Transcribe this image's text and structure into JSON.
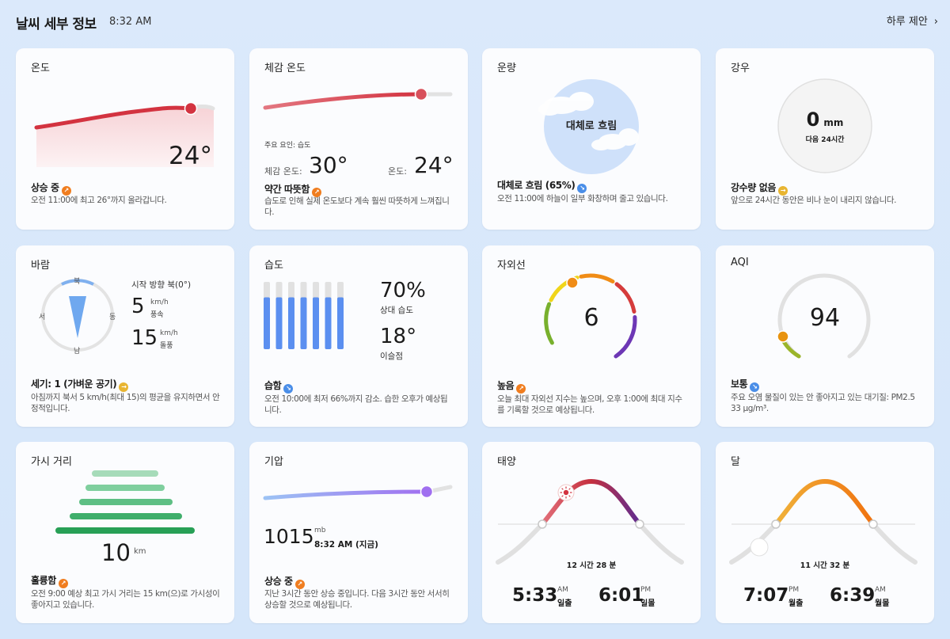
{
  "header": {
    "title": "날씨 세부 정보",
    "time": "8:32 AM",
    "daily_label": "하루 제안"
  },
  "temperature": {
    "title": "온도",
    "value": "24°",
    "status": "상승 중",
    "desc": "오전 11:00에 최고 26°까지 올라갑니다."
  },
  "feels_like": {
    "title": "체감 온도",
    "factor": "주요 요인: 습도",
    "feels_label": "체감 온도:",
    "feels_value": "30°",
    "temp_label": "온도:",
    "temp_value": "24°",
    "status": "약간 따뜻함",
    "desc": "습도로 인해 실제 온도보다 계속 훨씬 따뜻하게 느껴집니다."
  },
  "cloud": {
    "title": "운량",
    "center": "대체로 흐림",
    "status": "대체로 흐림 (65%)",
    "desc": "오전 11:00에 하늘이 일부 화창하며 줄고 있습니다."
  },
  "precip": {
    "title": "강우",
    "value": "0",
    "unit": "mm",
    "sub": "다음 24시간",
    "status": "강수량 없음",
    "desc": "앞으로 24시간 동안은 비나 눈이 내리지 않습니다."
  },
  "wind": {
    "title": "바람",
    "direction": "시작 방향 북(0°)",
    "n": "북",
    "s": "남",
    "e": "동",
    "w": "서",
    "speed": "5",
    "speed_unit": "km/h",
    "speed_label": "풍속",
    "gust": "15",
    "gust_unit": "km/h",
    "gust_label": "돌풍",
    "status": "세기: 1 (가벼운 공기)",
    "desc": "아침까지 북서 5 km/h(최대 15)의 평균을 유지하면서 안정적입니다."
  },
  "humidity": {
    "title": "습도",
    "value": "70%",
    "value_label": "상대 습도",
    "dew": "18°",
    "dew_label": "이슬점",
    "bars": [
      0.77,
      0.77,
      0.77,
      0.77,
      0.77,
      0.77,
      0.77
    ],
    "status": "습함",
    "desc": "오전 10:00에 최저 66%까지 감소. 습한 오후가 예상됩니다."
  },
  "uv": {
    "title": "자외선",
    "value": "6",
    "status": "높음",
    "desc": "오늘 최대 자외선 지수는 높으며, 오후 1:00에 최대 지수를 기록할 것으로 예상됩니다."
  },
  "aqi": {
    "title": "AQI",
    "value": "94",
    "status": "보통",
    "desc": "주요 오염 물질이 있는 안 좋아지고 있는 대기질: PM2.5 33 μg/m³."
  },
  "visibility": {
    "title": "가시 거리",
    "value": "10",
    "unit": "km",
    "status": "훌륭함",
    "desc": "오전 9:00 예상 최고 가시 거리는 15 km(으)로 가시성이 좋아지고 있습니다."
  },
  "pressure": {
    "title": "기압",
    "value": "1015",
    "unit": "mb",
    "time": "8:32 AM (지금)",
    "status": "상승 중",
    "desc": "지난 3시간 동안 상승 중입니다. 다음 3시간 동안 서서히 상승할 것으로 예상됩니다."
  },
  "sun": {
    "title": "태양",
    "duration": "12 시간 28 분",
    "rise": "5:33",
    "rise_ampm": "AM",
    "rise_label": "일출",
    "set": "6:01",
    "set_ampm": "PM",
    "set_label": "일몰"
  },
  "moon": {
    "title": "달",
    "duration": "11 시간 32 분",
    "rise": "7:07",
    "rise_ampm": "PM",
    "rise_label": "월출",
    "set": "6:39",
    "set_ampm": "AM",
    "set_label": "월몰"
  },
  "colors": {
    "accent_up": "#f07d1f",
    "accent_down": "#4a8ee8",
    "temp_line": "#d33340",
    "pressure_line": "#a06ff0",
    "humidity_bar": "#5b8ff0"
  }
}
